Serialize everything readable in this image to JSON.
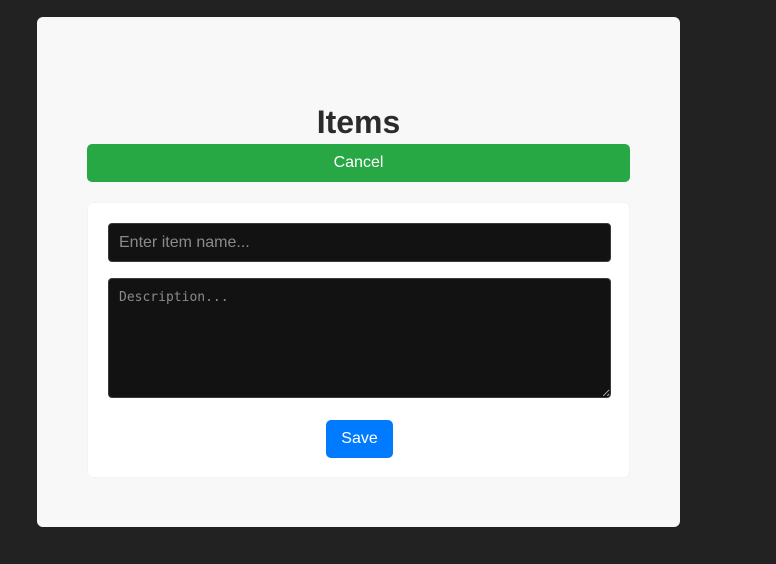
{
  "page": {
    "title": "Items"
  },
  "actions": {
    "cancel_label": "Cancel",
    "save_label": "Save"
  },
  "form": {
    "name_placeholder": "Enter item name...",
    "name_value": "",
    "description_placeholder": "Description...",
    "description_value": ""
  },
  "colors": {
    "background": "#222222",
    "card": "#f8f8f8",
    "cancel": "#28a745",
    "save": "#007bff",
    "input_bg": "#121212"
  }
}
